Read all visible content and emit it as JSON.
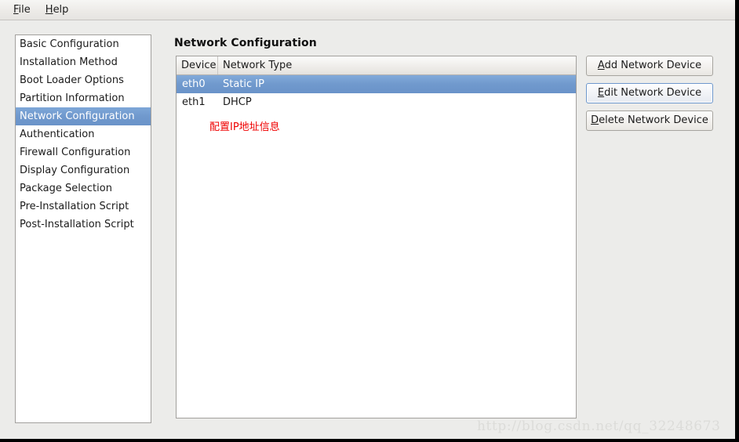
{
  "window": {
    "menubar": [
      {
        "label": "File",
        "mnemonic": "F",
        "rest": "ile"
      },
      {
        "label": "Help",
        "mnemonic": "H",
        "rest": "elp"
      }
    ]
  },
  "sidebar": {
    "items": [
      {
        "label": "Basic Configuration",
        "selected": false
      },
      {
        "label": "Installation Method",
        "selected": false
      },
      {
        "label": "Boot Loader Options",
        "selected": false
      },
      {
        "label": "Partition Information",
        "selected": false
      },
      {
        "label": "Network Configuration",
        "selected": true
      },
      {
        "label": "Authentication",
        "selected": false
      },
      {
        "label": "Firewall Configuration",
        "selected": false
      },
      {
        "label": "Display Configuration",
        "selected": false
      },
      {
        "label": "Package Selection",
        "selected": false
      },
      {
        "label": "Pre-Installation Script",
        "selected": false
      },
      {
        "label": "Post-Installation Script",
        "selected": false
      }
    ]
  },
  "main": {
    "title": "Network Configuration",
    "table": {
      "columns": [
        "Device",
        "Network Type"
      ],
      "rows": [
        {
          "device": "eth0",
          "type": "Static IP",
          "selected": true
        },
        {
          "device": "eth1",
          "type": "DHCP",
          "selected": false
        }
      ]
    },
    "annotation": {
      "text": "配置IP地址信息",
      "color": "#ef0000"
    }
  },
  "buttons": [
    {
      "mnemonic": "A",
      "rest": "dd Network Device",
      "focused": false
    },
    {
      "mnemonic": "E",
      "rest": "dit Network Device",
      "focused": true
    },
    {
      "mnemonic": "D",
      "rest": "elete Network Device",
      "focused": false
    }
  ],
  "watermark": {
    "text": "http://blog.csdn.net/qq_32248673"
  },
  "colors": {
    "selection_blue": "#7099cd",
    "focus_border": "#6d97cc",
    "window_bg": "#ececea",
    "panel_bg": "#ffffff"
  }
}
